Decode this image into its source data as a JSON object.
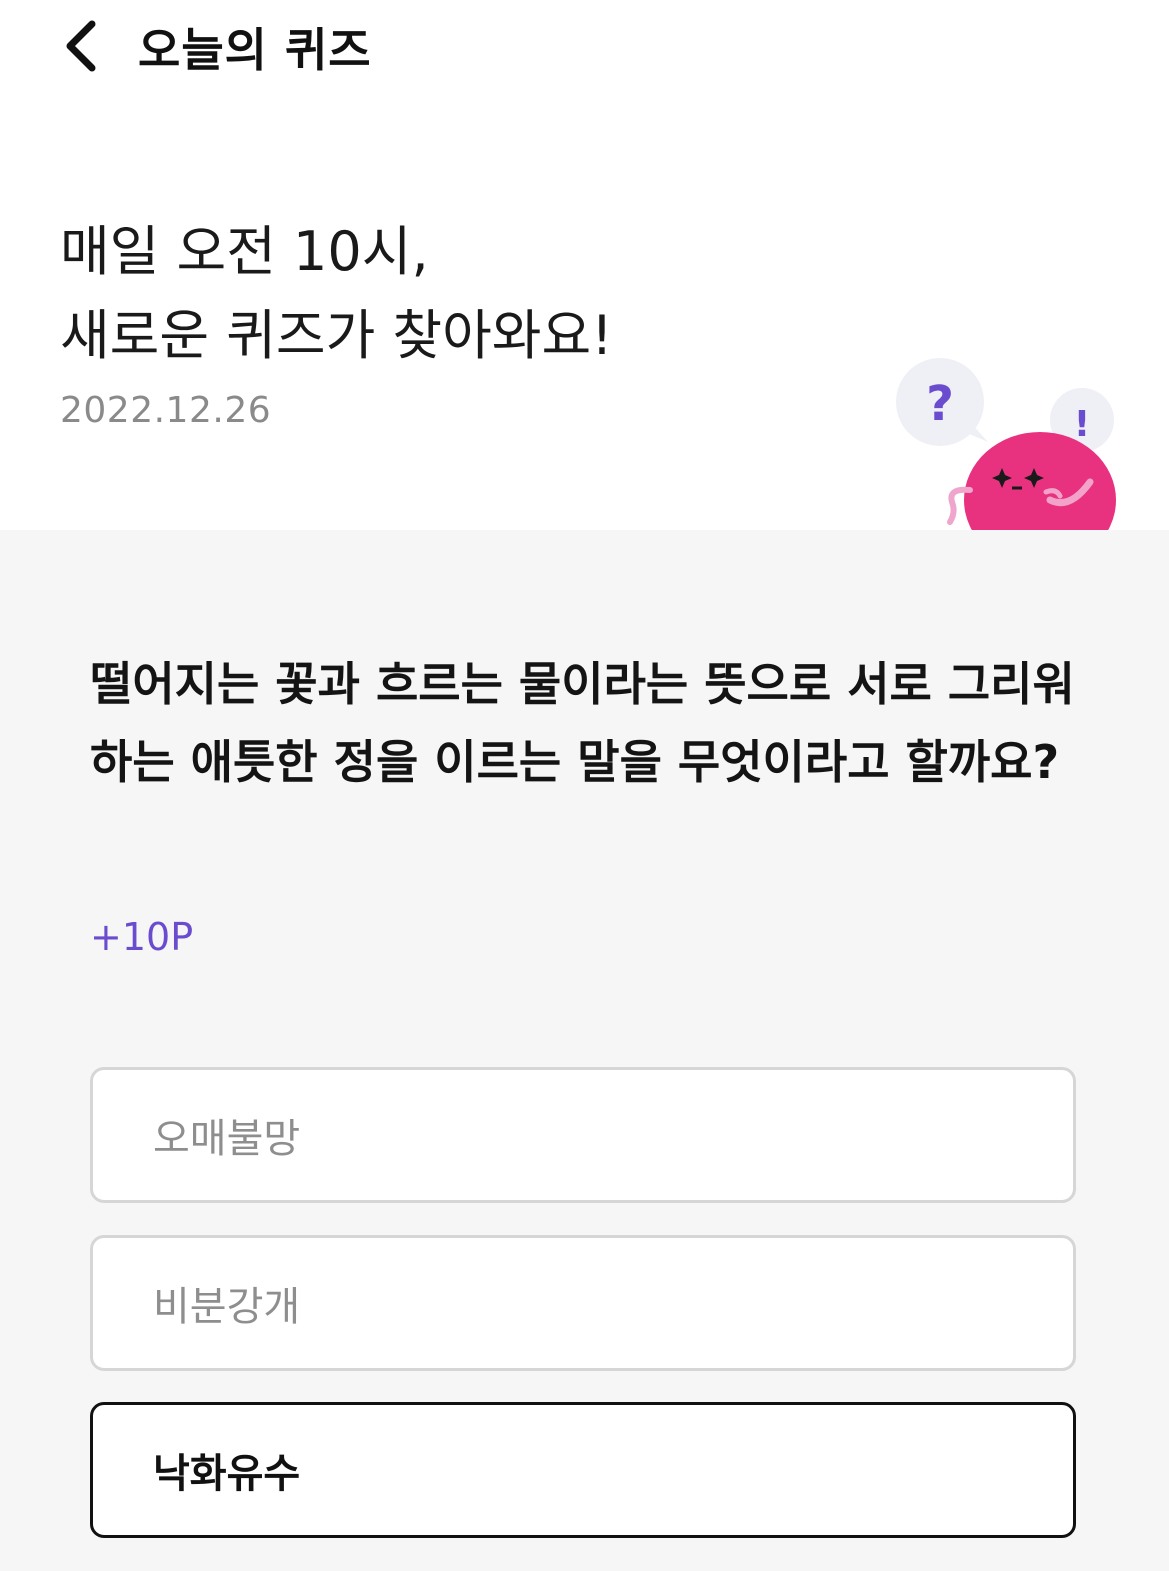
{
  "header": {
    "back_icon": "chevron-left-icon",
    "title": "오늘의 퀴즈"
  },
  "intro": {
    "line1": "매일 오전 10시,",
    "line2": "새로운 퀴즈가 찾아와요!",
    "date": "2022.12.26"
  },
  "mascot": {
    "question_mark": "?",
    "exclamation": "!",
    "colors": {
      "body": "#e8327f",
      "bubble": "#eeeef7",
      "accent": "#6a4ccf"
    }
  },
  "quiz": {
    "question": "떨어지는 꽃과 흐르는 물이라는 뜻으로 서로 그리워하는 애틋한 정을 이르는 말을 무엇이라고 할까요?",
    "points": "+10P",
    "options": [
      {
        "label": "오매불망",
        "selected": false
      },
      {
        "label": "비분강개",
        "selected": false
      },
      {
        "label": "낙화유수",
        "selected": true
      }
    ]
  },
  "colors": {
    "accent": "#6a4ccf",
    "background": "#f6f6f6",
    "selected_border": "#111111",
    "default_border": "#d6d6d6"
  }
}
